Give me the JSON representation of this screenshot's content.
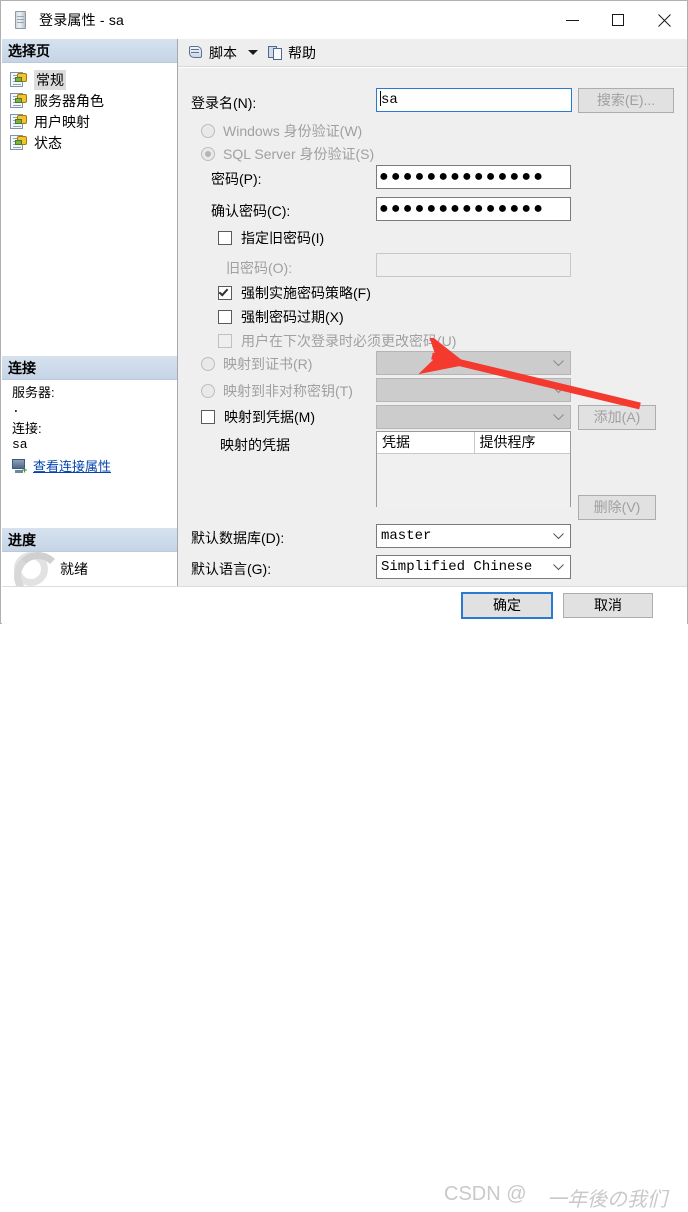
{
  "window": {
    "title": "登录属性 - sa",
    "icon": "login-properties-icon",
    "minimize": "–",
    "maximize": "□",
    "close": "✕"
  },
  "sidebar": {
    "select_page_header": "选择页",
    "pages": [
      {
        "label": "常规",
        "selected": true
      },
      {
        "label": "服务器角色",
        "selected": false
      },
      {
        "label": "用户映射",
        "selected": false
      },
      {
        "label": "状态",
        "selected": false
      }
    ],
    "connection": {
      "header": "连接",
      "server_label": "服务器:",
      "server_value": ".",
      "connection_label": "连接:",
      "connection_value": "sa",
      "view_properties_link": "查看连接属性"
    },
    "progress": {
      "header": "进度",
      "status": "就绪"
    }
  },
  "toolbar": {
    "script_label": "脚本",
    "help_label": "帮助"
  },
  "form": {
    "login_name_label": "登录名(N):",
    "login_name_value": "sa",
    "search_button": "搜索(E)...",
    "windows_auth_label": "Windows 身份验证(W)",
    "sql_auth_label": "SQL Server 身份验证(S)",
    "password_label": "密码(P):",
    "password_value": "●●●●●●●●●●●●●●",
    "confirm_password_label": "确认密码(C):",
    "confirm_password_value": "●●●●●●●●●●●●●●",
    "specify_old_password_label": "指定旧密码(I)",
    "old_password_label": "旧密码(O):",
    "old_password_value": "",
    "enforce_policy_label": "强制实施密码策略(F)",
    "enforce_expiration_label": "强制密码过期(X)",
    "must_change_label": "用户在下次登录时必须更改密码(U)",
    "map_certificate_label": "映射到证书(R)",
    "map_certificate_value": "",
    "map_asymmetric_key_label": "映射到非对称密钥(T)",
    "map_asymmetric_key_value": "",
    "map_credential_label": "映射到凭据(M)",
    "map_credential_value": "",
    "add_button": "添加(A)",
    "mapped_credentials_label": "映射的凭据",
    "credentials_grid": {
      "columns": [
        "凭据",
        "提供程序"
      ],
      "rows": []
    },
    "remove_button": "删除(V)",
    "default_database_label": "默认数据库(D):",
    "default_database_value": "master",
    "default_language_label": "默认语言(G):",
    "default_language_value": "Simplified Chinese"
  },
  "footer": {
    "ok_button": "确定",
    "cancel_button": "取消"
  },
  "watermark": {
    "prefix": "CSDN @",
    "suffix": "一年後の我们"
  },
  "annotation": {
    "arrow_color": "#f43a2f",
    "points_to": "强制实施密码策略(F)"
  }
}
